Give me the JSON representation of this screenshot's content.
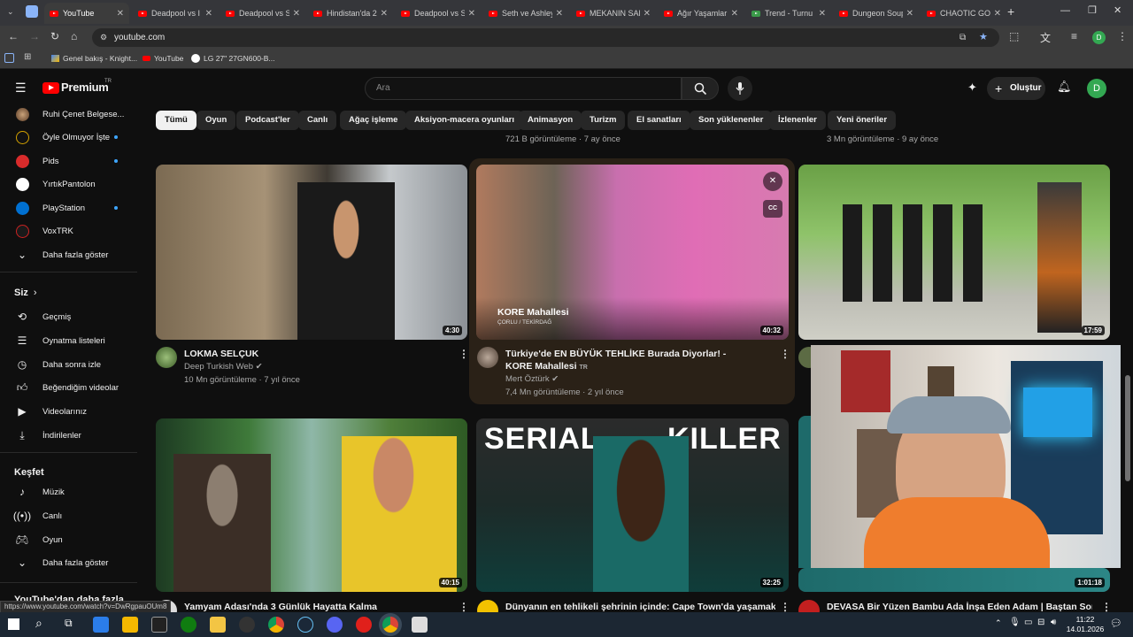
{
  "browser": {
    "tabs": [
      "YouTube",
      "Deadpool vs I",
      "Deadpool vs S",
      "Hindistan'da 2",
      "Deadpool vs S",
      "Seth ve Ashley",
      "MEKANIN SAH",
      "Ağır Yaşamlar",
      "Trend - Turnu",
      "Dungeon Soup",
      "CHAOTIC GOD"
    ],
    "url": "youtube.com",
    "bookmarks": [
      "Genel bakış - Knight...",
      "YouTube",
      "LG 27\" 27GN600-B..."
    ],
    "profile_initial": "D",
    "status_url": "https://www.youtube.com/watch?v=DwRgpauOUm8"
  },
  "header": {
    "logo": "Premium",
    "region": "TR",
    "search_placeholder": "Ara",
    "create_label": "Oluştur",
    "avatar_initial": "D"
  },
  "sidebar": {
    "subscriptions": [
      "Ruhi Çenet Belgese...",
      "Öyle Olmuyor İşte",
      "Pids",
      "YırtıkPantolon",
      "PlayStation",
      "VoxTRK"
    ],
    "show_more": "Daha fazla göster",
    "you_header": "Siz",
    "you_items": [
      "Geçmiş",
      "Oynatma listeleri",
      "Daha sonra izle",
      "Beğendiğim videolar",
      "Videolarınız",
      "İndirilenler"
    ],
    "explore_header": "Keşfet",
    "explore_items": [
      "Müzik",
      "Canlı",
      "Oyun",
      "Daha fazla göster"
    ],
    "bottom_header": "YouTube'dan daha fazla"
  },
  "chips": [
    "Tümü",
    "Oyun",
    "Podcast'ler",
    "Canlı",
    "Ağaç işleme",
    "Aksiyon-macera oyunları",
    "Animasyon",
    "Turizm",
    "El sanatları",
    "Son yüklenenler",
    "İzlenenler",
    "Yeni öneriler"
  ],
  "previous_meta": [
    "721 B görüntüleme · 7 ay önce",
    "3 Mn görüntüleme · 9 ay önce"
  ],
  "videos": [
    {
      "title": "LOKMA SELÇUK",
      "channel": "Deep Turkish Web",
      "meta": "10 Mn görüntüleme · 7 yıl önce",
      "duration": "4:30"
    },
    {
      "title": "Türkiye'de EN BÜYÜK TEHLİKE Burada Diyorlar! - KORE Mahallesi",
      "channel": "Mert Öztürk",
      "meta": "7,4 Mn görüntüleme · 2 yıl önce",
      "duration": "40:32",
      "overlay_title": "KORE Mahallesi",
      "overlay_sub": "ÇORLU / TEKİRDAĞ",
      "badge": "TR"
    },
    {
      "title": "",
      "channel": "",
      "meta": "",
      "duration": "17:59"
    },
    {
      "title": "Yamyam Adası'nda 3 Günlük Hayatta Kalma",
      "duration": "40:15"
    },
    {
      "title": "Dünyanın en tehlikeli şehrinin içinde: Cape Town'da yaşamak ya",
      "duration": "32:25",
      "thumb_text_left": "SERIAL",
      "thumb_text_right": "KILLER"
    },
    {
      "title": "DEVASA Bir Yüzen Bambu Ada İnşa Eden Adam | Baştan Sona",
      "duration": "1:01:18"
    }
  ],
  "taskbar": {
    "time": "11:22",
    "date": "14.01.2026"
  }
}
